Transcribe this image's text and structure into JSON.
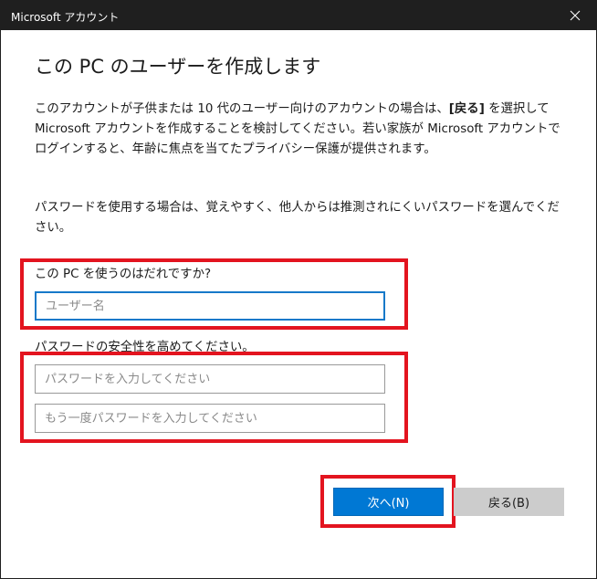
{
  "window": {
    "title": "Microsoft アカウント",
    "close_icon": "close-icon"
  },
  "main": {
    "heading": "この PC のユーザーを作成します",
    "para1_part1": "このアカウントが子供または 10 代のユーザー向けのアカウントの場合は、",
    "para1_bold": "[戻る]",
    "para1_part2": " を選択して Microsoft アカウントを作成することを検討してください。若い家族が Microsoft アカウントでログインすると、年齢に焦点を当てたプライバシー保護が提供されます。",
    "para2": "パスワードを使用する場合は、覚えやすく、他人からは推測されにくいパスワードを選んでください。"
  },
  "form": {
    "user_label": "この PC を使うのはだれですか?",
    "user_placeholder": "ユーザー名",
    "user_value": "",
    "password_label": "パスワードの安全性を高めてください。",
    "password_placeholder": "パスワードを入力してください",
    "password_value": "",
    "confirm_placeholder": "もう一度パスワードを入力してください",
    "confirm_value": ""
  },
  "buttons": {
    "next_label": "次へ(N)",
    "back_label": "戻る(B)"
  },
  "colors": {
    "titlebar": "#1f1f1f",
    "accent": "#0078d4",
    "highlight": "#e3141f"
  }
}
